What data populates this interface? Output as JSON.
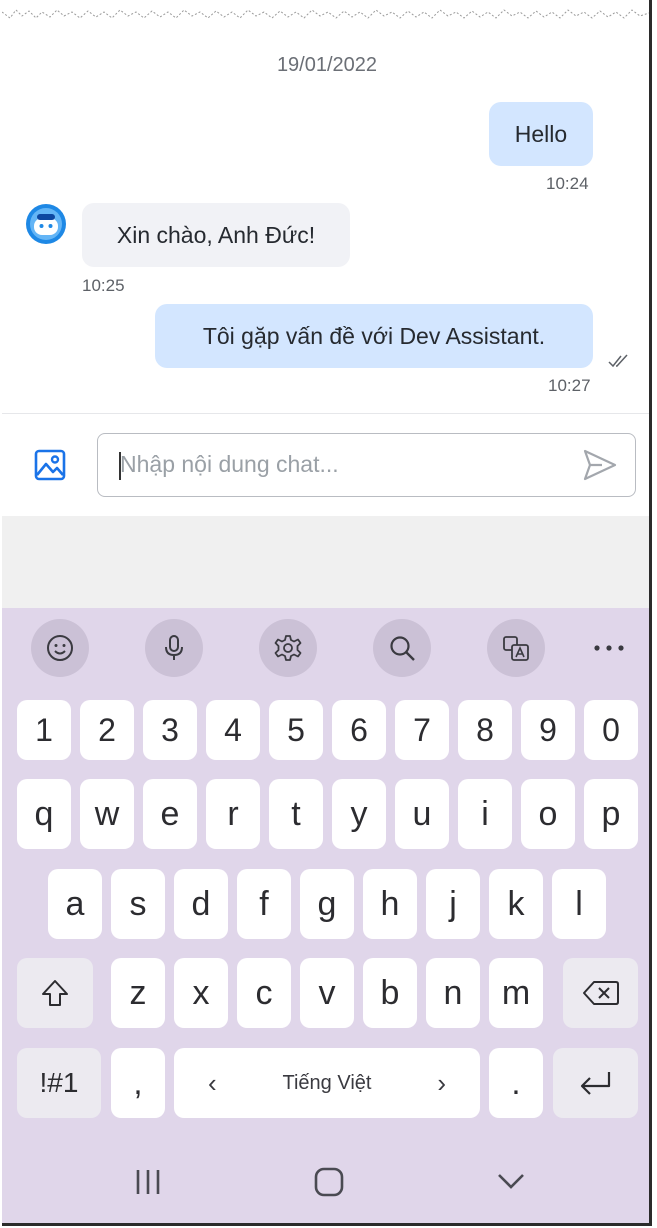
{
  "chat": {
    "date": "19/01/2022",
    "messages": [
      {
        "direction": "out",
        "text": "Hello",
        "time": "10:24"
      },
      {
        "direction": "in",
        "text": "Xin chào, Anh Đức!",
        "time": "10:25",
        "avatar": "assistant-avatar-icon"
      },
      {
        "direction": "out",
        "text": "Tôi gặp vấn đề với Dev Assistant.",
        "time": "10:27",
        "status_icon": "double-check-icon"
      }
    ]
  },
  "composer": {
    "placeholder": "Nhập nội dung chat...",
    "value": "",
    "image_icon": "image-icon",
    "send_icon": "send-icon"
  },
  "keyboard": {
    "toolbar": [
      "emoji-icon",
      "microphone-icon",
      "settings-icon",
      "search-icon",
      "translate-icon",
      "more-icon"
    ],
    "number_row": [
      "1",
      "2",
      "3",
      "4",
      "5",
      "6",
      "7",
      "8",
      "9",
      "0"
    ],
    "row1": [
      "q",
      "w",
      "e",
      "r",
      "t",
      "y",
      "u",
      "i",
      "o",
      "p"
    ],
    "row2": [
      "a",
      "s",
      "d",
      "f",
      "g",
      "h",
      "j",
      "k",
      "l"
    ],
    "row3": [
      "z",
      "x",
      "c",
      "v",
      "b",
      "n",
      "m"
    ],
    "symbols_label": "!#1",
    "comma_label": ",",
    "space_label": "Tiếng Việt",
    "space_left_arrow": "‹",
    "space_right_arrow": "›",
    "period_label": ".",
    "shift_icon": "shift-icon",
    "backspace_icon": "backspace-icon",
    "enter_icon": "enter-icon"
  },
  "navigation": [
    "recent-apps-icon",
    "home-icon",
    "back-icon"
  ],
  "colors": {
    "outgoing_bubble": "#d3e6ff",
    "incoming_bubble": "#f1f2f6",
    "keyboard_bg": "#e0d6ea",
    "accent": "#1a73e8"
  }
}
